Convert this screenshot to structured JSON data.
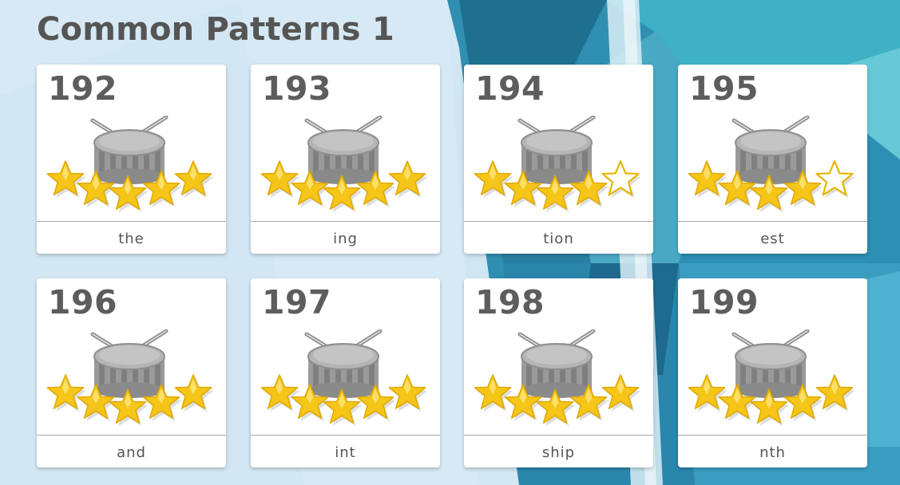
{
  "page": {
    "title": "Common Patterns 1"
  },
  "colors": {
    "star_filled": "#f5c518",
    "star_empty": "#ffffff",
    "text": "#555555",
    "card": "#ffffff"
  },
  "icons": {
    "card_icon": "drum-icon",
    "rating_icon": "star-icon"
  },
  "cards": [
    {
      "number": "192",
      "label": "the",
      "stars_filled": 5,
      "stars_total": 5
    },
    {
      "number": "193",
      "label": "ing",
      "stars_filled": 5,
      "stars_total": 5
    },
    {
      "number": "194",
      "label": "tion",
      "stars_filled": 4,
      "stars_total": 5
    },
    {
      "number": "195",
      "label": "est",
      "stars_filled": 4,
      "stars_total": 5
    },
    {
      "number": "196",
      "label": "and",
      "stars_filled": 5,
      "stars_total": 5
    },
    {
      "number": "197",
      "label": "int",
      "stars_filled": 5,
      "stars_total": 5
    },
    {
      "number": "198",
      "label": "ship",
      "stars_filled": 5,
      "stars_total": 5
    },
    {
      "number": "199",
      "label": "nth",
      "stars_filled": 5,
      "stars_total": 5
    }
  ]
}
